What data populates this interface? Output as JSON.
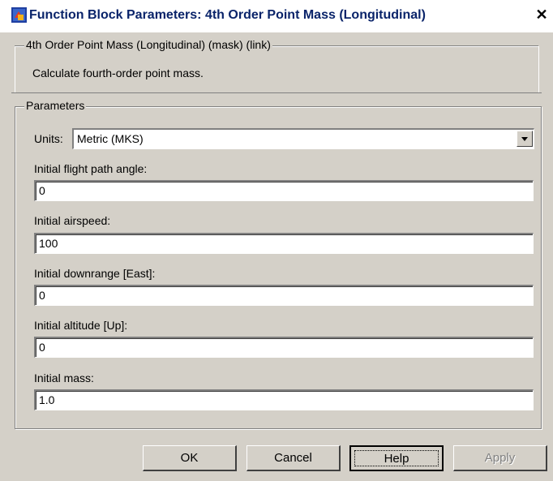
{
  "window": {
    "title": "Function Block Parameters: 4th Order Point Mass (Longitudinal)",
    "close_glyph": "✕"
  },
  "description_group": {
    "title": "4th Order Point Mass (Longitudinal) (mask) (link)",
    "text": "Calculate fourth-order point mass."
  },
  "parameters_group": {
    "title": "Parameters",
    "units_label": "Units:",
    "units_value": "Metric (MKS)",
    "fields": [
      {
        "label": "Initial flight path angle:",
        "value": "0"
      },
      {
        "label": "Initial airspeed:",
        "value": "100"
      },
      {
        "label": "Initial downrange [East]:",
        "value": "0"
      },
      {
        "label": "Initial altitude [Up]:",
        "value": "0"
      },
      {
        "label": "Initial mass:",
        "value": "1.0"
      }
    ]
  },
  "buttons": {
    "ok": "OK",
    "cancel": "Cancel",
    "help": "Help",
    "apply": "Apply"
  }
}
